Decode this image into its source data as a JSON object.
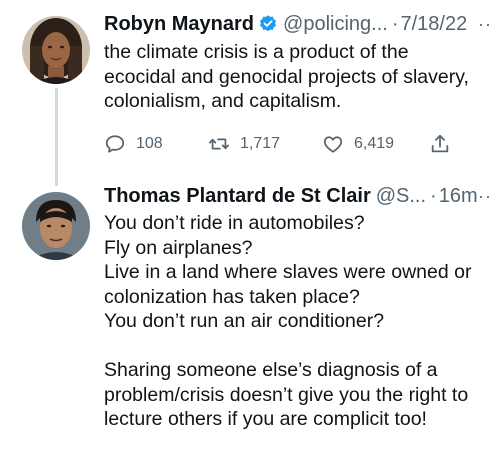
{
  "tweets": [
    {
      "author_name": "Robyn Maynard",
      "verified": true,
      "handle": "@policing...",
      "separator": "·",
      "time": "7/18/22",
      "more": "··",
      "text": "the climate crisis is a product of the\necocidal and genocidal projects of slavery,\ncolonialism, and capitalism.",
      "replies": "108",
      "retweets": "1,717",
      "likes": "6,419"
    },
    {
      "author_name": "Thomas Plantard de St Clair",
      "verified": false,
      "handle": "@S...",
      "separator": "·",
      "time": "16m",
      "more": "··",
      "text": "You don’t ride in automobiles?\nFly on airplanes?\nLive in a land where slaves were owned or\ncolonization has taken place?\nYou don’t run an air conditioner?\n\nSharing someone else’s diagnosis of a\nproblem/crisis doesn’t give you the right to\nlecture others if you are complicit too!"
    }
  ],
  "icons": {
    "reply": "reply-icon",
    "retweet": "retweet-icon",
    "like": "like-icon",
    "share": "share-icon",
    "verified": "verified-badge-icon"
  },
  "colors": {
    "text": "#0f1419",
    "secondary": "#536471",
    "verified": "#1d9bf0",
    "thread_line": "#cfd9de"
  }
}
